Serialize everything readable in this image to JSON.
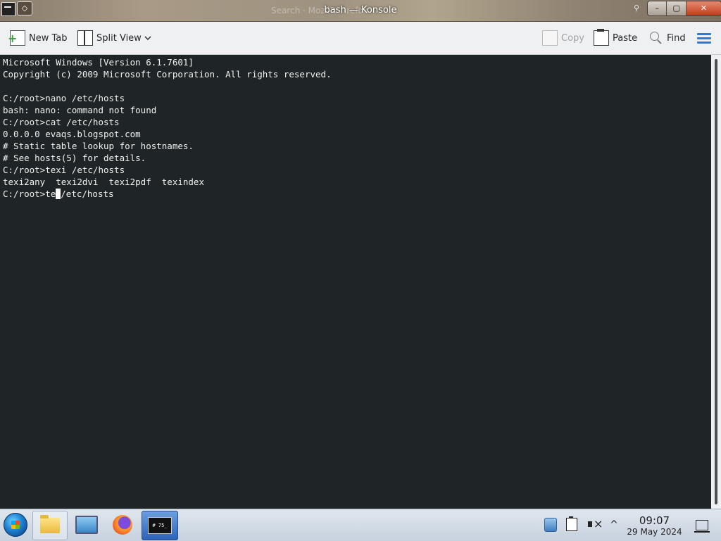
{
  "window": {
    "title": "bash — Konsole",
    "background_title": "Search · Mozilla Firefox",
    "controls": {
      "minimize": "–",
      "maximize": "▢",
      "close": "✕"
    }
  },
  "toolbar": {
    "new_tab_label": "New Tab",
    "split_view_label": "Split View",
    "copy_label": "Copy",
    "paste_label": "Paste",
    "find_label": "Find",
    "split_view_dropdown_icon": "chevron-down-icon",
    "menu_icon": "hamburger-menu-icon"
  },
  "terminal": {
    "lines": [
      "Microsoft Windows [Version 6.1.7601]",
      "Copyright (c) 2009 Microsoft Corporation. All rights reserved.",
      "",
      "C:/root>nano /etc/hosts",
      "bash: nano: command not found",
      "C:/root>cat /etc/hosts",
      "0.0.0.0 evaqs.blogspot.com",
      "# Static table lookup for hostnames.",
      "# See hosts(5) for details.",
      "C:/root>texi /etc/hosts",
      "texi2any  texi2dvi  texi2pdf  texindex"
    ],
    "prompt_before_cursor": "C:/root>te",
    "prompt_after_cursor": "/etc/hosts",
    "background_color": "#1f2526",
    "text_color": "#f0f0f0"
  },
  "taskbar": {
    "apps": [
      {
        "name": "file-manager",
        "icon": "folder-icon"
      },
      {
        "name": "computer",
        "icon": "computer-icon"
      },
      {
        "name": "firefox",
        "icon": "firefox-icon"
      },
      {
        "name": "konsole",
        "icon": "terminal-icon",
        "active": true
      }
    ],
    "konsole_icon_text": "# 75_",
    "tray": {
      "icons": [
        "network-icon",
        "clipboard-icon",
        "volume-muted-icon",
        "chevron-up-icon"
      ],
      "expand_glyph": "^"
    },
    "clock": {
      "time": "09:07",
      "date": "29 May 2024"
    }
  }
}
